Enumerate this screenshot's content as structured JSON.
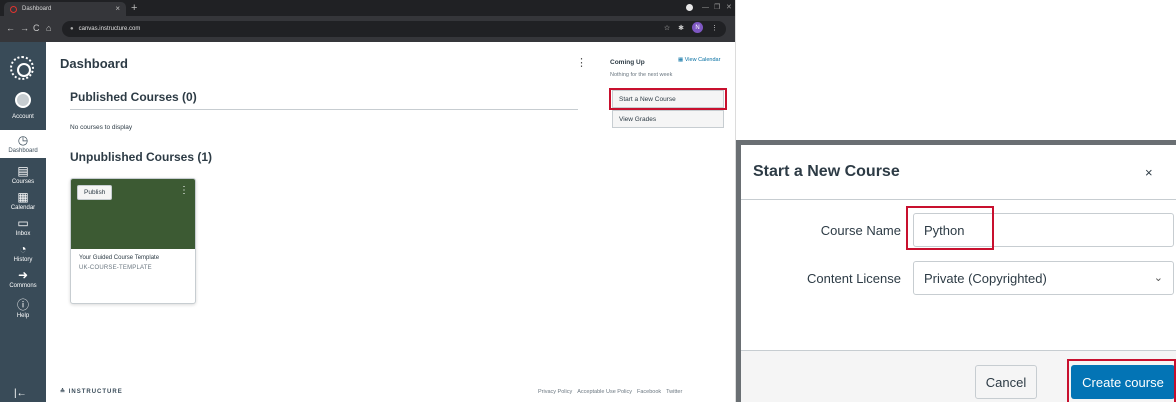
{
  "browser": {
    "tab_title": "Dashboard",
    "tab_close": "×",
    "new_tab": "+",
    "url": "canvas.instructure.com",
    "profile_initial": "N",
    "win_min": "—",
    "win_max": "❐",
    "win_close": "✕"
  },
  "global_nav": {
    "items": [
      {
        "label": "Account",
        "icon": "user-avatar-icon"
      },
      {
        "label": "Dashboard",
        "icon": "dashboard-icon"
      },
      {
        "label": "Courses",
        "icon": "book-icon"
      },
      {
        "label": "Calendar",
        "icon": "calendar-icon"
      },
      {
        "label": "Inbox",
        "icon": "inbox-icon"
      },
      {
        "label": "History",
        "icon": "clock-icon"
      },
      {
        "label": "Commons",
        "icon": "arrow-share-icon"
      },
      {
        "label": "Help",
        "icon": "info-icon"
      }
    ],
    "collapse_glyph": "|←"
  },
  "dashboard": {
    "title": "Dashboard",
    "published_title": "Published Courses (0)",
    "empty_message": "No courses to display",
    "unpublished_title": "Unpublished Courses (1)",
    "card": {
      "publish_label": "Publish",
      "course_name": "Your Guided Course Template",
      "course_code": "UK-COURSE-TEMPLATE",
      "hero_color": "#3c5a33"
    },
    "footer_brand": "INSTRUCTURE",
    "footer_links": [
      "Privacy Policy",
      "Acceptable Use Policy",
      "Facebook",
      "Twitter"
    ]
  },
  "sidebar": {
    "coming_up": "Coming Up",
    "view_calendar": "View Calendar",
    "nothing_message": "Nothing for the next week",
    "start_new_course": "Start a New Course",
    "view_grades": "View Grades"
  },
  "modal": {
    "title": "Start a New Course",
    "close_glyph": "×",
    "course_name_label": "Course Name",
    "course_name_value": "Python",
    "content_license_label": "Content License",
    "content_license_value": "Private (Copyrighted)",
    "cancel_label": "Cancel",
    "create_label": "Create course"
  },
  "colors": {
    "nav_bg": "#394b58",
    "primary_blue": "#0374b5",
    "highlight_red": "#c8102e"
  }
}
